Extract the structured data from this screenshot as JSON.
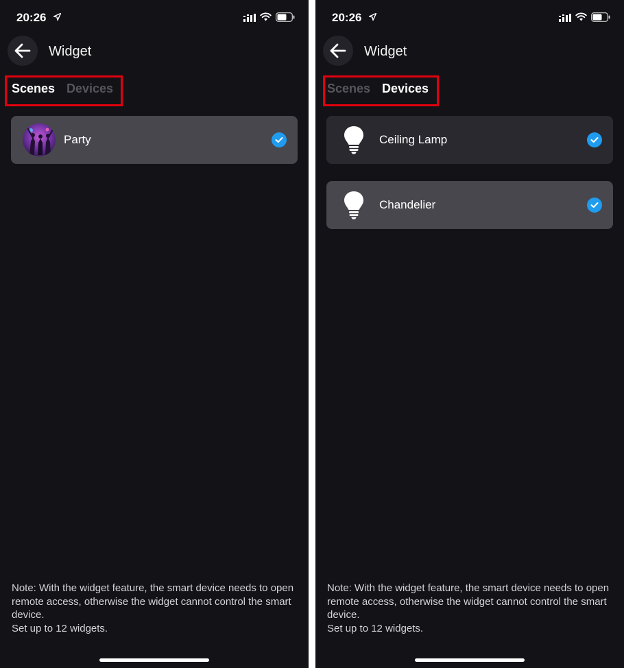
{
  "screens": [
    {
      "status": {
        "time": "20:26"
      },
      "header": {
        "title": "Widget"
      },
      "tabs": [
        {
          "label": "Scenes",
          "active": true
        },
        {
          "label": "Devices",
          "active": false
        }
      ],
      "items": [
        {
          "label": "Party",
          "icon": "scene-thumbnail",
          "checked": true
        }
      ],
      "note": {
        "line1": "Note: With the widget feature, the smart device needs to open remote access, otherwise the widget cannot control the smart device.",
        "line2": "Set up to 12 widgets."
      }
    },
    {
      "status": {
        "time": "20:26"
      },
      "header": {
        "title": "Widget"
      },
      "tabs": [
        {
          "label": "Scenes",
          "active": false
        },
        {
          "label": "Devices",
          "active": true
        }
      ],
      "items": [
        {
          "label": "Ceiling Lamp",
          "icon": "light-bulb-icon",
          "checked": true
        },
        {
          "label": "Chandelier",
          "icon": "light-bulb-icon",
          "checked": true
        }
      ],
      "note": {
        "line1": "Note: With the widget feature, the smart device needs to open remote access, otherwise the widget cannot control the smart device.",
        "line2": "Set up to 12 widgets."
      }
    }
  ],
  "colors": {
    "background": "#131217",
    "card": "#48474d",
    "card_alt": "#2a292f",
    "check": "#1f9cf0",
    "highlight": "#e0000e",
    "tab_inactive": "#56555c"
  }
}
